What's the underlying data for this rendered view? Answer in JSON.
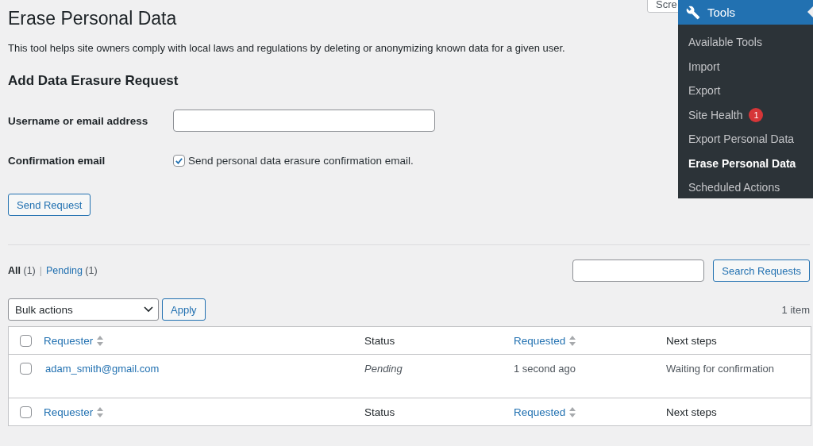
{
  "screen_options": {
    "label": "Scre"
  },
  "title": "Erase Personal Data",
  "description": "This tool helps site owners comply with local laws and regulations by deleting or anonymizing known data for a given user.",
  "form": {
    "heading": "Add Data Erasure Request",
    "fields": [
      {
        "kind": "text",
        "label": "Username or email address"
      },
      {
        "kind": "checkbox",
        "label": "Confirmation email",
        "text": "Send personal data erasure confirmation email.",
        "checked": true
      }
    ],
    "submit": "Send Request"
  },
  "views": [
    {
      "label": "All",
      "count": "(1)",
      "selected": true
    },
    {
      "label": "Pending",
      "count": "(1)",
      "selected": false
    }
  ],
  "view_separator": "|",
  "search_button": "Search Requests",
  "bulk_actions": {
    "value": "Bulk actions",
    "apply": "Apply"
  },
  "item_count": "1 item",
  "table": {
    "columns": [
      {
        "label": "Requester",
        "sortable": true
      },
      {
        "label": "Status",
        "sortable": false
      },
      {
        "label": "Requested",
        "sortable": true
      },
      {
        "label": "Next steps",
        "sortable": false
      }
    ],
    "footer_columns": [
      {
        "label": "Requester",
        "sortable": true
      },
      {
        "label": "Status",
        "sortable": false
      },
      {
        "label": "Requested",
        "sortable": true
      },
      {
        "label": "Next steps",
        "sortable": false
      }
    ],
    "header_checked": false,
    "footer_checked": false,
    "rows": [
      {
        "requester": "adam_smith@gmail.com",
        "status": "Pending",
        "requested": "1 second ago",
        "next_steps": "Waiting for confirmation",
        "checked": false
      }
    ]
  },
  "menu": {
    "title": "Tools",
    "items": [
      {
        "label": "Available Tools",
        "selected": false
      },
      {
        "label": "Import",
        "selected": false
      },
      {
        "label": "Export",
        "selected": false
      },
      {
        "label": "Site Health",
        "selected": false,
        "badge": "1"
      },
      {
        "label": "Export Personal Data",
        "selected": false
      },
      {
        "label": "Erase Personal Data",
        "selected": true
      },
      {
        "label": "Scheduled Actions",
        "selected": false
      }
    ]
  }
}
